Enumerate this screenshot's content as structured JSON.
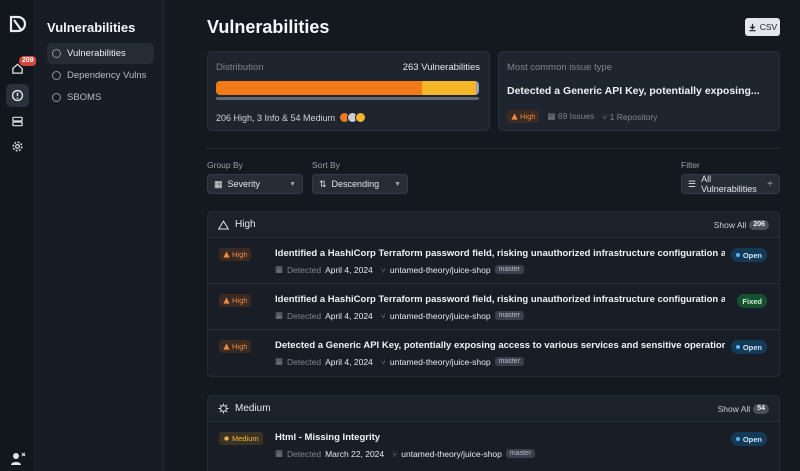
{
  "rail": {
    "badge": "209"
  },
  "sidebar": {
    "title": "Vulnerabilities",
    "items": [
      {
        "label": "Vulnerabilities"
      },
      {
        "label": "Dependency Vulns"
      },
      {
        "label": "SBOMS"
      }
    ]
  },
  "header": {
    "title": "Vulnerabilities",
    "csv_label": "CSV"
  },
  "distribution": {
    "label": "Distribution",
    "count_text": "263 Vulnerabilities",
    "summary": "206 High, 3 Info & 54 Medium",
    "segments": [
      {
        "name": "High",
        "count": 206,
        "color": "#f07a1a"
      },
      {
        "name": "Medium",
        "count": 54,
        "color": "#f5b528"
      },
      {
        "name": "Info",
        "count": 3,
        "color": "#9aa3ad"
      }
    ]
  },
  "common": {
    "label": "Most common issue type",
    "title": "Detected a Generic API Key, potentially exposing...",
    "severity": "High",
    "issues": "69 Issues",
    "repos": "1 Repository"
  },
  "controls": {
    "group_by_label": "Group By",
    "group_by_value": "Severity",
    "sort_by_label": "Sort By",
    "sort_by_value": "Descending",
    "filter_label": "Filter",
    "filter_value": "All Vulnerabilities"
  },
  "groups": {
    "high": {
      "title": "High",
      "show_all": "Show All",
      "count": "206",
      "rows": [
        {
          "severity": "High",
          "title": "Identified a HashiCorp Terraform password field, risking unauthorized infrastructure configuration and...",
          "detected_label": "Detected",
          "date": "April 4, 2024",
          "repo": "untamed-theory/juice-shop",
          "branch": "master",
          "status": "Open"
        },
        {
          "severity": "High",
          "title": "Identified a HashiCorp Terraform password field, risking unauthorized infrastructure configuration and...",
          "detected_label": "Detected",
          "date": "April 4, 2024",
          "repo": "untamed-theory/juice-shop",
          "branch": "master",
          "status": "Fixed"
        },
        {
          "severity": "High",
          "title": "Detected a Generic API Key, potentially exposing access to various services and sensitive operations.",
          "detected_label": "Detected",
          "date": "April 4, 2024",
          "repo": "untamed-theory/juice-shop",
          "branch": "master",
          "status": "Open"
        }
      ]
    },
    "medium": {
      "title": "Medium",
      "show_all": "Show All",
      "count": "54",
      "rows": [
        {
          "severity": "Medium",
          "title": "Html - Missing Integrity",
          "detected_label": "Detected",
          "date": "March 22, 2024",
          "repo": "untamed-theory/juice-shop",
          "branch": "master",
          "status": "Open"
        }
      ]
    }
  }
}
